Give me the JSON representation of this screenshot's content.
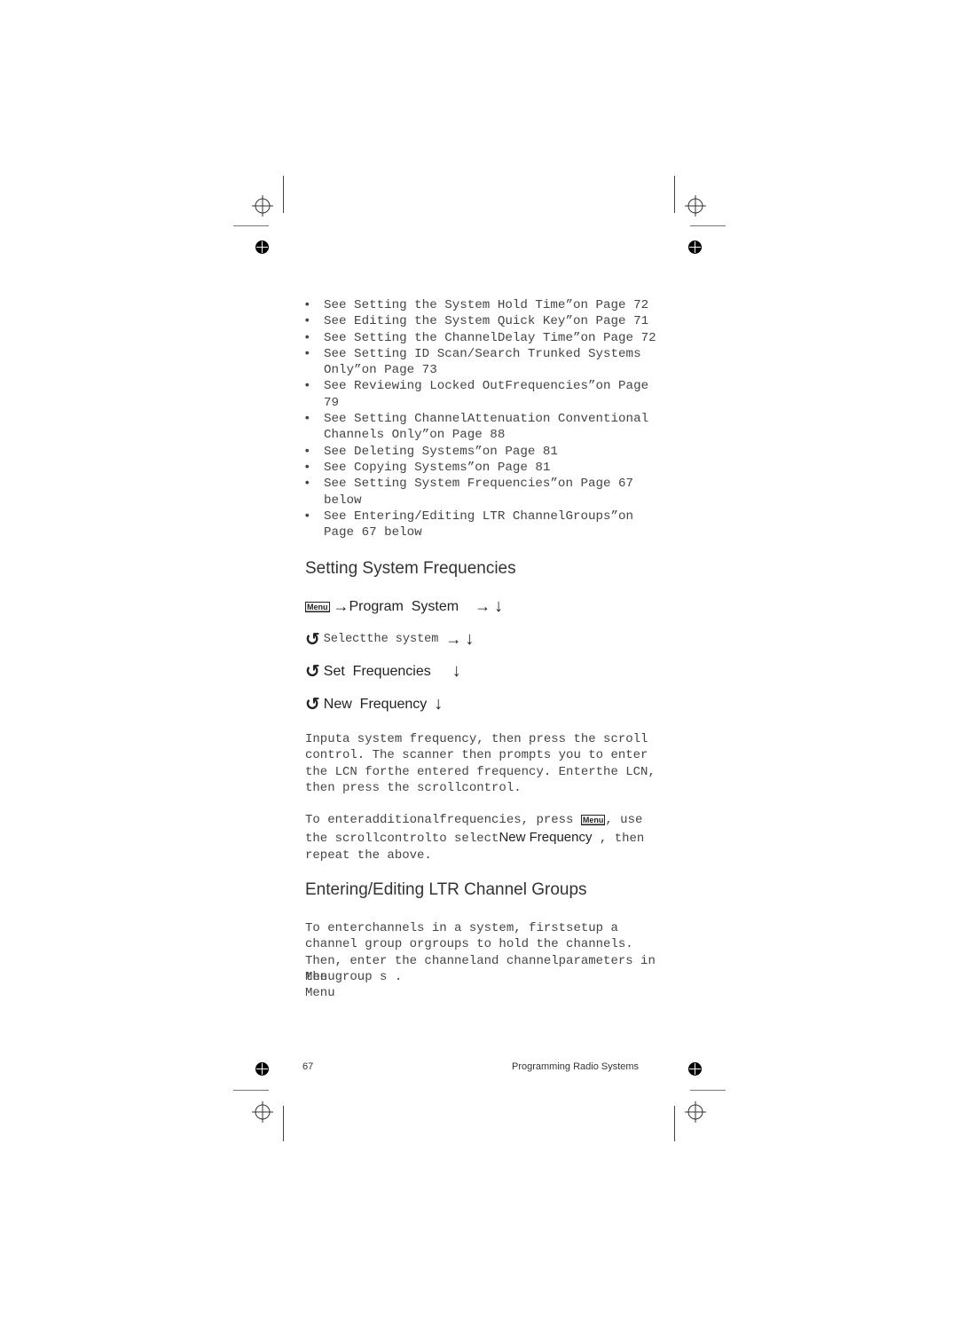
{
  "bullets": [
    {
      "text": "See  Setting the System  Hold Time”on Page 72"
    },
    {
      "text": "See  Editing the System  Quick Key”on Page 71"
    },
    {
      "text": "See  Setting the ChannelDelay Time”on Page 72"
    },
    {
      "text": "See  Setting ID Scan/Search  Trunked Systems Only”on Page 73"
    },
    {
      "text": "See  Reviewing Locked OutFrequencies”on Page 79"
    },
    {
      "text": "See  Setting ChannelAttenuation  Conventional Channels Only”on Page 88"
    },
    {
      "text": "See  Deleting Systems”on Page 81"
    },
    {
      "text": "See  Copying Systems”on Page 81"
    },
    {
      "text": "See  Setting System  Frequencies”on Page 67  below"
    },
    {
      "text": "See  Entering/Editing LTR ChannelGroups”on Page 67  below"
    }
  ],
  "bullet_glyph": "•",
  "section1": {
    "title": "Setting System Frequencies",
    "steps": {
      "menu_key": "Menu",
      "step1_label": "Program  System",
      "step2_label": "Selectthe system",
      "step3_label": "Set  Frequencies",
      "step4_label": "New  Frequency"
    },
    "icons": {
      "arrow_right": "→",
      "arrow_down": "↓",
      "scroll": "↺"
    },
    "para1": "Inputa system  frequency, then press the scroll control. The scanner then prompts you to enter the LCN forthe entered frequency. Enterthe LCN, then press the scrollcontrol.",
    "para2_a": "To enteradditionalfrequencies, press",
    "para2_menu": "Menu",
    "para2_b": ", use the scrollcontrolto select",
    "para2_highlight": "New  Frequency",
    "para2_c": " , then repeat the above."
  },
  "section2": {
    "title": "Entering/Editing LTR Channel Groups",
    "para1": "To enterchannels in a system, firstsetup a channel group  orgroups  to hold the channels. Then, enter the channeland channelparameters in the group s .",
    "line_menu1": "Menu",
    "line_menu2": "Menu"
  },
  "footer": {
    "page_number": "67",
    "chapter": "Programming Radio Systems"
  }
}
